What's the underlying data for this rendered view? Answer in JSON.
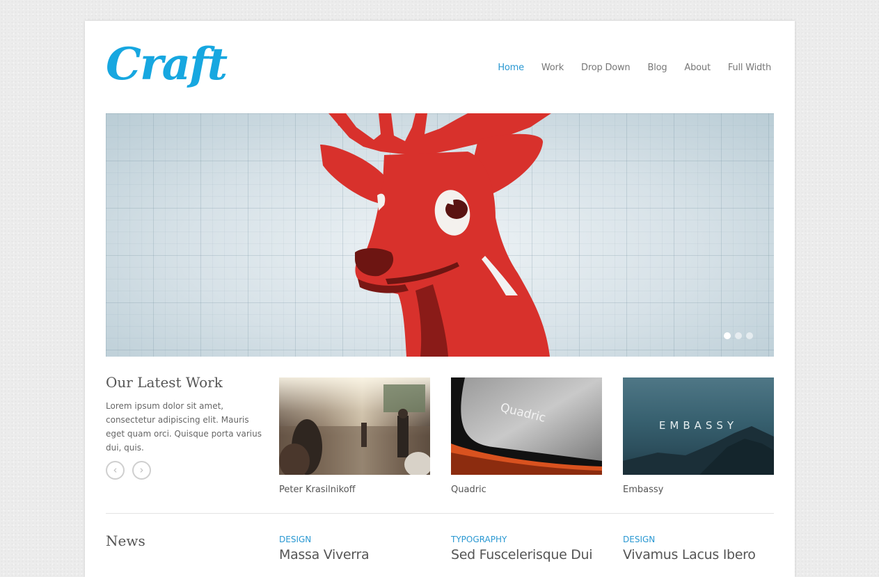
{
  "brand": {
    "logo": "Craft",
    "accent_color": "#17a7e0"
  },
  "nav": {
    "items": [
      "Home",
      "Work",
      "Drop Down",
      "Blog",
      "About",
      "Full Width"
    ],
    "active": "Home"
  },
  "slider": {
    "image": "red-deer-illustration",
    "slide_count": 3,
    "active_slide": 1
  },
  "latest": {
    "title": "Our Latest Work",
    "description": "Lorem ipsum dolor sit amet, consectetur adipiscing elit. Mauris eget quam orci. Quisque porta varius dui, quis.",
    "prev_icon": "chevron-left-icon",
    "next_icon": "chevron-right-icon",
    "items": [
      {
        "caption": "Peter Krasilnikoff",
        "image": "city-street-photo"
      },
      {
        "caption": "Quadric",
        "image": "book-cover-photo",
        "overlay_text": "Quadric"
      },
      {
        "caption": "Embassy",
        "image": "mountain-photo",
        "overlay_text": "EMBASSY"
      }
    ]
  },
  "news": {
    "title": "News",
    "posts": [
      {
        "category": "DESIGN",
        "title": "Massa Viverra"
      },
      {
        "category": "TYPOGRAPHY",
        "title": "Sed Fuscelerisque Dui"
      },
      {
        "category": "DESIGN",
        "title": "Vivamus Lacus Ibero"
      }
    ]
  }
}
